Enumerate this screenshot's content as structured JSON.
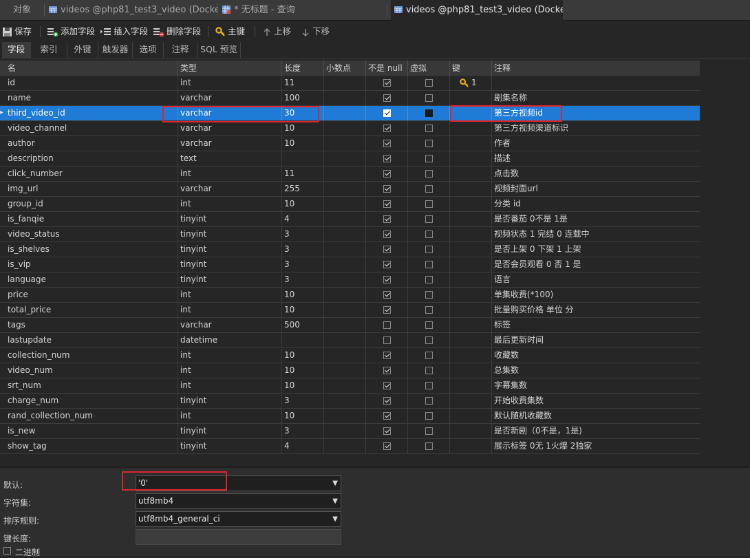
{
  "tabs": [
    {
      "label": "对象"
    },
    {
      "label": "videos @php81_test3_video (Docker..."
    },
    {
      "label": "* 无标题 - 查询"
    },
    {
      "label": "videos @php81_test3_video (Docker..."
    }
  ],
  "toolbar": {
    "save": "保存",
    "add_field": "添加字段",
    "insert_field": "插入字段",
    "delete_field": "删除字段",
    "primary_key": "主键",
    "move_up": "上移",
    "move_down": "下移"
  },
  "subtabs": [
    "字段",
    "索引",
    "外键",
    "触发器",
    "选项",
    "注释",
    "SQL 预览"
  ],
  "columns": [
    "名",
    "类型",
    "长度",
    "小数点",
    "不是 null",
    "虚拟",
    "键",
    "注释"
  ],
  "rows": [
    {
      "name": "id",
      "type": "int",
      "length": "11",
      "notnull": true,
      "key": "1",
      "comment": ""
    },
    {
      "name": "name",
      "type": "varchar",
      "length": "100",
      "notnull": true,
      "key": "",
      "comment": "剧集名称"
    },
    {
      "name": "third_video_id",
      "type": "varchar",
      "length": "30",
      "notnull": true,
      "key": "",
      "comment": "第三方视频id"
    },
    {
      "name": "video_channel",
      "type": "varchar",
      "length": "10",
      "notnull": true,
      "key": "",
      "comment": "第三方视频渠道标识"
    },
    {
      "name": "author",
      "type": "varchar",
      "length": "10",
      "notnull": true,
      "key": "",
      "comment": "作者"
    },
    {
      "name": "description",
      "type": "text",
      "length": "",
      "notnull": true,
      "key": "",
      "comment": "描述"
    },
    {
      "name": "click_number",
      "type": "int",
      "length": "11",
      "notnull": true,
      "key": "",
      "comment": "点击数"
    },
    {
      "name": "img_url",
      "type": "varchar",
      "length": "255",
      "notnull": true,
      "key": "",
      "comment": "视频封面url"
    },
    {
      "name": "group_id",
      "type": "int",
      "length": "10",
      "notnull": true,
      "key": "",
      "comment": "分类 id"
    },
    {
      "name": "is_fanqie",
      "type": "tinyint",
      "length": "4",
      "notnull": true,
      "key": "",
      "comment": "是否番茄 0不是 1是"
    },
    {
      "name": "video_status",
      "type": "tinyint",
      "length": "3",
      "notnull": true,
      "key": "",
      "comment": "视频状态 1 完结 0 连载中"
    },
    {
      "name": "is_shelves",
      "type": "tinyint",
      "length": "3",
      "notnull": true,
      "key": "",
      "comment": "是否上架  0 下架  1 上架"
    },
    {
      "name": "is_vip",
      "type": "tinyint",
      "length": "3",
      "notnull": true,
      "key": "",
      "comment": "是否会员观看  0 否  1 是"
    },
    {
      "name": "language",
      "type": "tinyint",
      "length": "3",
      "notnull": true,
      "key": "",
      "comment": "语言"
    },
    {
      "name": "price",
      "type": "int",
      "length": "10",
      "notnull": true,
      "key": "",
      "comment": "单集收费(*100)"
    },
    {
      "name": "total_price",
      "type": "int",
      "length": "10",
      "notnull": true,
      "key": "",
      "comment": "批量购买价格 单位 分"
    },
    {
      "name": "tags",
      "type": "varchar",
      "length": "500",
      "notnull": false,
      "key": "",
      "comment": "标签"
    },
    {
      "name": "lastupdate",
      "type": "datetime",
      "length": "",
      "notnull": false,
      "key": "",
      "comment": "最后更新时间"
    },
    {
      "name": "collection_num",
      "type": "int",
      "length": "10",
      "notnull": true,
      "key": "",
      "comment": "收藏数"
    },
    {
      "name": "video_num",
      "type": "int",
      "length": "10",
      "notnull": true,
      "key": "",
      "comment": "总集数"
    },
    {
      "name": "srt_num",
      "type": "int",
      "length": "10",
      "notnull": true,
      "key": "",
      "comment": "字幕集数"
    },
    {
      "name": "charge_num",
      "type": "tinyint",
      "length": "3",
      "notnull": true,
      "key": "",
      "comment": "开始收费集数"
    },
    {
      "name": "rand_collection_num",
      "type": "int",
      "length": "10",
      "notnull": true,
      "key": "",
      "comment": "默认随机收藏数"
    },
    {
      "name": "is_new",
      "type": "tinyint",
      "length": "3",
      "notnull": true,
      "key": "",
      "comment": "是否新剧（0不是，1是)"
    },
    {
      "name": "show_tag",
      "type": "tinyint",
      "length": "4",
      "notnull": true,
      "key": "",
      "comment": "展示标签 0无 1火爆 2独家"
    }
  ],
  "selected_row": 2,
  "properties": {
    "default_label": "默认:",
    "default_value": "'0'",
    "charset_label": "字符集:",
    "charset_value": "utf8mb4",
    "collation_label": "排序规则:",
    "collation_value": "utf8mb4_general_ci",
    "key_length_label": "键长度:",
    "binary_label": "二进制"
  },
  "colors": {
    "selection": "#1f7bd6",
    "highlight_box": "#e0242c",
    "key_icon": "#e8b020"
  }
}
